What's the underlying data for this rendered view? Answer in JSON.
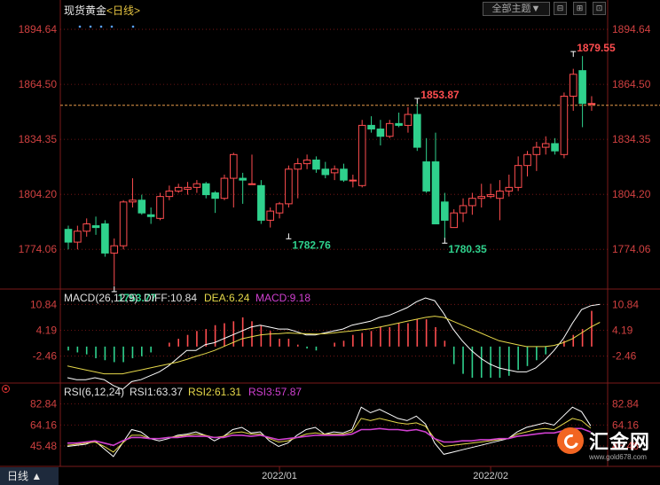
{
  "header": {
    "instrument": "现货黄金",
    "period": "<日线>",
    "theme_button": "全部主题▼",
    "window_buttons": [
      "⊟",
      "⊞",
      "⊡"
    ]
  },
  "footer": {
    "period_button": "日线 ▲",
    "logo_text": "汇金网",
    "logo_url": "www.gold678.com"
  },
  "colors": {
    "up": "#ff4d4f",
    "down": "#2fd18d",
    "diff": "#ffffff",
    "dea": "#e6d84a",
    "rsi1": "#ffffff",
    "rsi2": "#e6d84a",
    "rsi3": "#d040d0",
    "grid": "#8a1a1a"
  },
  "chart_data": [
    {
      "type": "candlestick",
      "ylim": [
        1762,
        1901
      ],
      "y_ticks": [
        "1894.64",
        "1864.50",
        "1834.35",
        "1804.20",
        "1774.06"
      ],
      "x_tick_labels": [
        {
          "index": 23,
          "label": "2022/01"
        },
        {
          "index": 46,
          "label": "2022/02"
        }
      ],
      "current_price": 1853.0,
      "annotations": [
        {
          "index": 5,
          "value": 1753.77,
          "label": "1753.77",
          "kind": "low"
        },
        {
          "index": 24,
          "value": 1782.76,
          "label": "1782.76",
          "kind": "low"
        },
        {
          "index": 38,
          "value": 1853.87,
          "label": "1853.87",
          "kind": "high"
        },
        {
          "index": 41,
          "value": 1780.35,
          "label": "1780.35",
          "kind": "low"
        },
        {
          "index": 55,
          "value": 1879.55,
          "label": "1879.55",
          "kind": "high"
        }
      ],
      "candles": [
        {
          "o": 1785,
          "h": 1787,
          "l": 1774,
          "c": 1778
        },
        {
          "o": 1778,
          "h": 1787,
          "l": 1774,
          "c": 1784
        },
        {
          "o": 1784,
          "h": 1791,
          "l": 1781,
          "c": 1788
        },
        {
          "o": 1787,
          "h": 1792,
          "l": 1782,
          "c": 1786
        },
        {
          "o": 1788,
          "h": 1790,
          "l": 1770,
          "c": 1772
        },
        {
          "o": 1772,
          "h": 1780,
          "l": 1754,
          "c": 1776
        },
        {
          "o": 1776,
          "h": 1801,
          "l": 1774,
          "c": 1800
        },
        {
          "o": 1800,
          "h": 1813,
          "l": 1797,
          "c": 1801
        },
        {
          "o": 1801,
          "h": 1804,
          "l": 1793,
          "c": 1794
        },
        {
          "o": 1793,
          "h": 1797,
          "l": 1788,
          "c": 1792
        },
        {
          "o": 1791,
          "h": 1805,
          "l": 1790,
          "c": 1803
        },
        {
          "o": 1803,
          "h": 1809,
          "l": 1801,
          "c": 1806
        },
        {
          "o": 1806,
          "h": 1810,
          "l": 1805,
          "c": 1808
        },
        {
          "o": 1807,
          "h": 1811,
          "l": 1804,
          "c": 1808
        },
        {
          "o": 1808,
          "h": 1812,
          "l": 1805,
          "c": 1810
        },
        {
          "o": 1810,
          "h": 1811,
          "l": 1802,
          "c": 1804
        },
        {
          "o": 1805,
          "h": 1806,
          "l": 1794,
          "c": 1802
        },
        {
          "o": 1802,
          "h": 1815,
          "l": 1801,
          "c": 1813
        },
        {
          "o": 1813,
          "h": 1827,
          "l": 1797,
          "c": 1826
        },
        {
          "o": 1813,
          "h": 1816,
          "l": 1799,
          "c": 1812
        },
        {
          "o": 1810,
          "h": 1826,
          "l": 1810,
          "c": 1810
        },
        {
          "o": 1809,
          "h": 1812,
          "l": 1788,
          "c": 1790
        },
        {
          "o": 1790,
          "h": 1797,
          "l": 1786,
          "c": 1795
        },
        {
          "o": 1794,
          "h": 1800,
          "l": 1791,
          "c": 1799
        },
        {
          "o": 1799,
          "h": 1820,
          "l": 1797,
          "c": 1818
        },
        {
          "o": 1818,
          "h": 1824,
          "l": 1802,
          "c": 1821
        },
        {
          "o": 1821,
          "h": 1826,
          "l": 1818,
          "c": 1823
        },
        {
          "o": 1823,
          "h": 1825,
          "l": 1816,
          "c": 1818
        },
        {
          "o": 1818,
          "h": 1822,
          "l": 1813,
          "c": 1815
        },
        {
          "o": 1816,
          "h": 1820,
          "l": 1812,
          "c": 1818
        },
        {
          "o": 1818,
          "h": 1821,
          "l": 1811,
          "c": 1812
        },
        {
          "o": 1812,
          "h": 1815,
          "l": 1808,
          "c": 1812
        },
        {
          "o": 1809,
          "h": 1845,
          "l": 1808,
          "c": 1842
        },
        {
          "o": 1842,
          "h": 1847,
          "l": 1838,
          "c": 1840
        },
        {
          "o": 1840,
          "h": 1845,
          "l": 1831,
          "c": 1836
        },
        {
          "o": 1836,
          "h": 1845,
          "l": 1835,
          "c": 1843
        },
        {
          "o": 1843,
          "h": 1849,
          "l": 1841,
          "c": 1842
        },
        {
          "o": 1842,
          "h": 1852,
          "l": 1838,
          "c": 1848
        },
        {
          "o": 1848,
          "h": 1854,
          "l": 1828,
          "c": 1830
        },
        {
          "o": 1822,
          "h": 1835,
          "l": 1805,
          "c": 1806
        },
        {
          "o": 1822,
          "h": 1838,
          "l": 1800,
          "c": 1788
        },
        {
          "o": 1800,
          "h": 1805,
          "l": 1780,
          "c": 1790
        },
        {
          "o": 1786,
          "h": 1796,
          "l": 1788,
          "c": 1794
        },
        {
          "o": 1794,
          "h": 1802,
          "l": 1789,
          "c": 1798
        },
        {
          "o": 1798,
          "h": 1805,
          "l": 1793,
          "c": 1802
        },
        {
          "o": 1802,
          "h": 1810,
          "l": 1797,
          "c": 1803
        },
        {
          "o": 1803,
          "h": 1810,
          "l": 1802,
          "c": 1804
        },
        {
          "o": 1802,
          "h": 1812,
          "l": 1790,
          "c": 1806
        },
        {
          "o": 1806,
          "h": 1815,
          "l": 1803,
          "c": 1808
        },
        {
          "o": 1808,
          "h": 1825,
          "l": 1806,
          "c": 1820
        },
        {
          "o": 1820,
          "h": 1828,
          "l": 1814,
          "c": 1826
        },
        {
          "o": 1826,
          "h": 1833,
          "l": 1817,
          "c": 1830
        },
        {
          "o": 1830,
          "h": 1836,
          "l": 1826,
          "c": 1832
        },
        {
          "o": 1832,
          "h": 1835,
          "l": 1826,
          "c": 1828
        },
        {
          "o": 1826,
          "h": 1860,
          "l": 1824,
          "c": 1858
        },
        {
          "o": 1858,
          "h": 1873,
          "l": 1850,
          "c": 1870
        },
        {
          "o": 1872,
          "h": 1880,
          "l": 1841,
          "c": 1854
        },
        {
          "o": 1854,
          "h": 1858,
          "l": 1850,
          "c": 1854
        }
      ]
    },
    {
      "type": "bar",
      "name": "MACD",
      "label": "MACD(26,12,9)",
      "legend": {
        "diff": "DIFF:10.84",
        "dea": "DEA:6.24",
        "macd": "MACD:9.18"
      },
      "ylim": [
        -8,
        12.5
      ],
      "y_ticks": [
        "10.84",
        "4.19",
        "-2.46"
      ],
      "diff": [
        -8,
        -8.5,
        -8.5,
        -8,
        -8.5,
        -10,
        -11,
        -9,
        -8.5,
        -7.5,
        -6.5,
        -5,
        -3,
        -1,
        -1,
        0.5,
        1,
        2,
        3,
        4,
        5,
        5.5,
        5,
        4.5,
        4.5,
        3.8,
        3,
        3,
        3.5,
        4,
        4.5,
        5.5,
        6,
        6.5,
        7.5,
        8,
        9,
        10,
        11.5,
        12.5,
        11.8,
        8.5,
        4.5,
        1.5,
        -1,
        -3,
        -4.5,
        -5.5,
        -6,
        -6.5,
        -6.5,
        -5.5,
        -3.5,
        -1,
        2,
        6,
        9.5,
        10.5,
        10.84
      ],
      "dea": [
        -5,
        -5.5,
        -6,
        -6.5,
        -7,
        -7,
        -7,
        -6.5,
        -6,
        -5.5,
        -5,
        -4.5,
        -4,
        -3.3,
        -2.5,
        -1.8,
        -1,
        0,
        1,
        2,
        2.5,
        3,
        3.2,
        3.3,
        3.5,
        3.4,
        3.3,
        3.2,
        3.3,
        3.5,
        3.8,
        4,
        4.3,
        4.6,
        5,
        5.5,
        6,
        6.5,
        7,
        7.5,
        7.8,
        7.5,
        6.5,
        5.5,
        4.5,
        3.5,
        2.5,
        1.5,
        1,
        0.5,
        0,
        0,
        0,
        0.3,
        1,
        2,
        3.5,
        5,
        6.24
      ],
      "macd": [
        -1,
        -1.5,
        -2,
        -3,
        -3.5,
        -4,
        -4,
        -3,
        -2.5,
        -1.5,
        0,
        1,
        2,
        3,
        4,
        4.5,
        5.5,
        6,
        6.5,
        7.5,
        6.5,
        5.5,
        4,
        2,
        2,
        0.5,
        -0.5,
        -1,
        0,
        1,
        1.5,
        3,
        3.5,
        4,
        5,
        5,
        6,
        6,
        7,
        7,
        5,
        1.5,
        -4.5,
        -7,
        -8,
        -8,
        -8,
        -8,
        -7.5,
        -6,
        -5,
        -3.5,
        -2,
        0,
        1.5,
        3,
        4.5,
        9.18
      ]
    },
    {
      "type": "line",
      "name": "RSI",
      "label": "RSI(6,12,24)",
      "legend": {
        "rsi1": "RSI1:63.37",
        "rsi2": "RSI2:61.31",
        "rsi3": "RSI3:57.87"
      },
      "ylim": [
        32,
        92
      ],
      "y_ticks": [
        "82.84",
        "64.16",
        "45.48"
      ],
      "series": [
        {
          "name": "RSI1",
          "values": [
            45,
            46,
            47,
            50,
            43,
            36,
            48,
            60,
            58,
            52,
            50,
            52,
            55,
            56,
            58,
            55,
            50,
            54,
            60,
            62,
            57,
            58,
            50,
            45,
            48,
            55,
            60,
            62,
            56,
            58,
            57,
            60,
            80,
            75,
            78,
            74,
            70,
            68,
            72,
            65,
            48,
            38,
            40,
            42,
            44,
            46,
            48,
            50,
            52,
            58,
            62,
            64,
            66,
            64,
            72,
            80,
            76,
            63.37
          ]
        },
        {
          "name": "RSI2",
          "values": [
            46,
            47,
            48,
            49,
            45,
            40,
            48,
            55,
            55,
            52,
            52,
            53,
            54,
            55,
            56,
            55,
            53,
            54,
            57,
            58,
            56,
            56,
            52,
            49,
            50,
            53,
            56,
            57,
            56,
            56,
            56,
            58,
            70,
            68,
            70,
            68,
            66,
            65,
            66,
            63,
            52,
            45,
            46,
            47,
            48,
            49,
            50,
            51,
            52,
            56,
            58,
            60,
            61,
            60,
            65,
            70,
            68,
            61.31
          ]
        },
        {
          "name": "RSI3",
          "values": [
            48,
            48,
            49,
            50,
            48,
            46,
            50,
            53,
            53,
            52,
            52,
            53,
            53,
            54,
            54,
            54,
            53,
            53,
            55,
            55,
            54,
            55,
            53,
            51,
            52,
            53,
            54,
            55,
            55,
            55,
            55,
            56,
            60,
            60,
            61,
            60,
            60,
            59,
            60,
            58,
            52,
            49,
            49,
            50,
            50,
            51,
            51,
            52,
            52,
            54,
            55,
            56,
            57,
            57,
            59,
            61,
            61,
            57.87
          ]
        }
      ]
    }
  ]
}
